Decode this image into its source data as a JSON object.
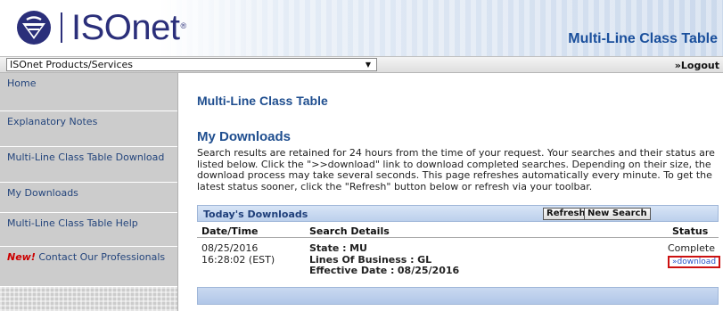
{
  "header": {
    "logo_text": "ISOnet",
    "logo_reg": "®",
    "title": "Multi-Line Class Table"
  },
  "navbar": {
    "products_select": "ISOnet Products/Services",
    "logout": "»Logout"
  },
  "sidebar": {
    "items": [
      {
        "label": "Home"
      },
      {
        "label": "Explanatory Notes"
      },
      {
        "label": "Multi-Line Class Table Download"
      },
      {
        "label": "My Downloads"
      },
      {
        "label": "Multi-Line Class Table Help"
      },
      {
        "label": "Contact Our Professionals",
        "badge": "New!"
      }
    ]
  },
  "main": {
    "page_title": "Multi-Line Class Table",
    "section_title": "My Downloads",
    "intro": "Search results are retained for 24 hours from the time of your request. Your searches and their status are listed below. Click the \">>download\" link to download completed searches. Depending on their size, the download process may take several seconds. This page refreshes automatically every minute. To get the latest status sooner, click the \"Refresh\" button below or refresh via your toolbar."
  },
  "downloads": {
    "title": "Today's Downloads",
    "refresh_label": "Refresh",
    "new_search_label": "New Search",
    "columns": [
      "Date/Time",
      "Search Details",
      "Status"
    ],
    "rows": [
      {
        "date": "08/25/2016",
        "time": "16:28:02 (EST)",
        "state_label": "State :",
        "state_value": "MU",
        "lob_label": "Lines Of Business :",
        "lob_value": "GL",
        "eff_label": "Effective Date :",
        "eff_value": "08/25/2016",
        "status": "Complete",
        "download_label": "»download"
      }
    ]
  },
  "colors": {
    "brand_navy": "#2b2f7a",
    "title_blue": "#1f4e8f",
    "sidebar_gray": "#cccccc",
    "highlight_red": "#cc1111"
  }
}
